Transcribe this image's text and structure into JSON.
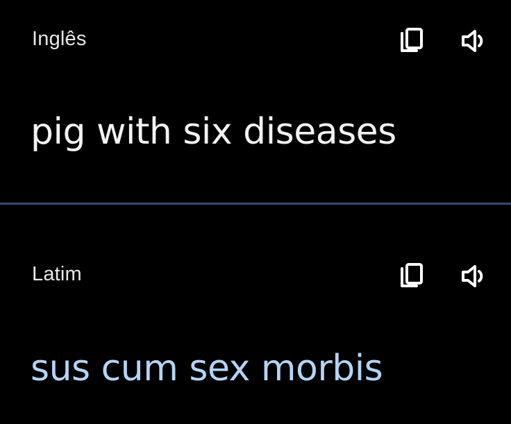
{
  "source": {
    "language": "Inglês",
    "text": "pig with six diseases",
    "text_color": "#f2f2f2",
    "icons": [
      "copy-icon",
      "speaker-icon"
    ]
  },
  "divider_color": "#2f4c78",
  "target": {
    "language": "Latim",
    "text": "sus cum sex morbis",
    "text_color": "#b3d4f5",
    "icons": [
      "copy-icon",
      "speaker-icon"
    ]
  }
}
